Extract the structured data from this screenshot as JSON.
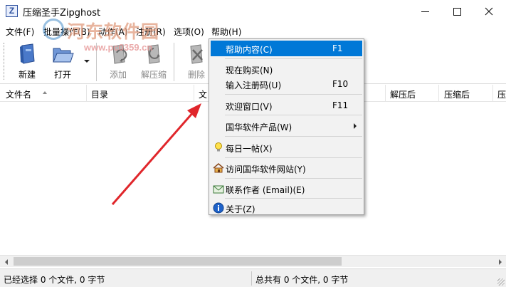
{
  "window": {
    "icon_letter": "Z",
    "title": "压缩圣手Zipghost"
  },
  "menubar": {
    "items": [
      {
        "label": "文件(F)"
      },
      {
        "label": "批量操作(B)"
      },
      {
        "label": "动作(A)"
      },
      {
        "label": "注册(R)"
      },
      {
        "label": "选项(O)"
      },
      {
        "label": "帮助(H)"
      }
    ]
  },
  "toolbar": {
    "tools": [
      {
        "label": "新建",
        "icon": "new-archive-icon",
        "enabled": true
      },
      {
        "label": "打开",
        "icon": "open-folder-icon",
        "enabled": true
      },
      {
        "label": "添加",
        "icon": "add-files-icon",
        "enabled": false
      },
      {
        "label": "解压缩",
        "icon": "extract-icon",
        "enabled": false
      },
      {
        "label": "删除",
        "icon": "delete-icon",
        "enabled": false
      }
    ]
  },
  "columns": [
    "文件名",
    "目录",
    "文",
    "解压后",
    "压缩后",
    "压"
  ],
  "scrollbar": {
    "left_arrow": "◀",
    "right_arrow": "▶"
  },
  "status": {
    "left": "已经选择 0 个文件, 0 字节",
    "right": "总共有 0 个文件, 0 字节"
  },
  "help_menu": {
    "items": [
      {
        "label": "帮助内容(C)",
        "shortcut": "F1",
        "highlighted": true
      },
      {
        "label": "现在购买(N)",
        "shortcut": ""
      },
      {
        "label": "输入注册码(U)",
        "shortcut": "F10"
      },
      {
        "label": "欢迎窗口(V)",
        "shortcut": "F11"
      },
      {
        "label": "国华软件产品(W)",
        "shortcut": "",
        "submenu": true
      },
      {
        "label": "每日一帖(X)",
        "shortcut": "",
        "icon": "lightbulb-icon"
      },
      {
        "label": "访问国华软件网站(Y)",
        "shortcut": "",
        "icon": "home-icon"
      },
      {
        "label": "联系作者 (Email)(E)",
        "shortcut": "",
        "icon": "email-icon"
      },
      {
        "label": "关于(Z)",
        "shortcut": "",
        "icon": "info-icon"
      }
    ]
  },
  "watermark": {
    "site": "河东软件园",
    "url": "www.pc0359.cn"
  },
  "colors": {
    "highlight": "#0078d7",
    "annotation_arrow": "#e0262b",
    "disabled_text": "#8a8a8a"
  }
}
